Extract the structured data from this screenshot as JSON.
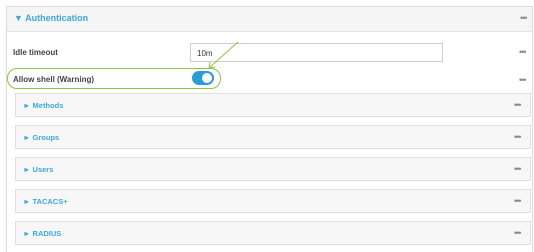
{
  "auth": {
    "title": "Authentication",
    "caret": "▼",
    "menu_icon": "•••"
  },
  "idle_timeout": {
    "label": "Idle timeout",
    "value": "10m",
    "menu_icon": "•••"
  },
  "allow_shell": {
    "label": "Allow shell (Warning)",
    "enabled": true,
    "menu_icon": "•••"
  },
  "sections": [
    {
      "caret": "►",
      "label": "Methods",
      "menu_icon": "•••"
    },
    {
      "caret": "►",
      "label": "Groups",
      "menu_icon": "•••"
    },
    {
      "caret": "►",
      "label": "Users",
      "menu_icon": "•••"
    },
    {
      "caret": "►",
      "label": "TACACS+",
      "menu_icon": "•••"
    },
    {
      "caret": "►",
      "label": "RADIUS",
      "menu_icon": "•••"
    }
  ],
  "colors": {
    "accent": "#3ca8dc",
    "toggle_on": "#2d9bd6",
    "highlight": "#8cc63f"
  }
}
